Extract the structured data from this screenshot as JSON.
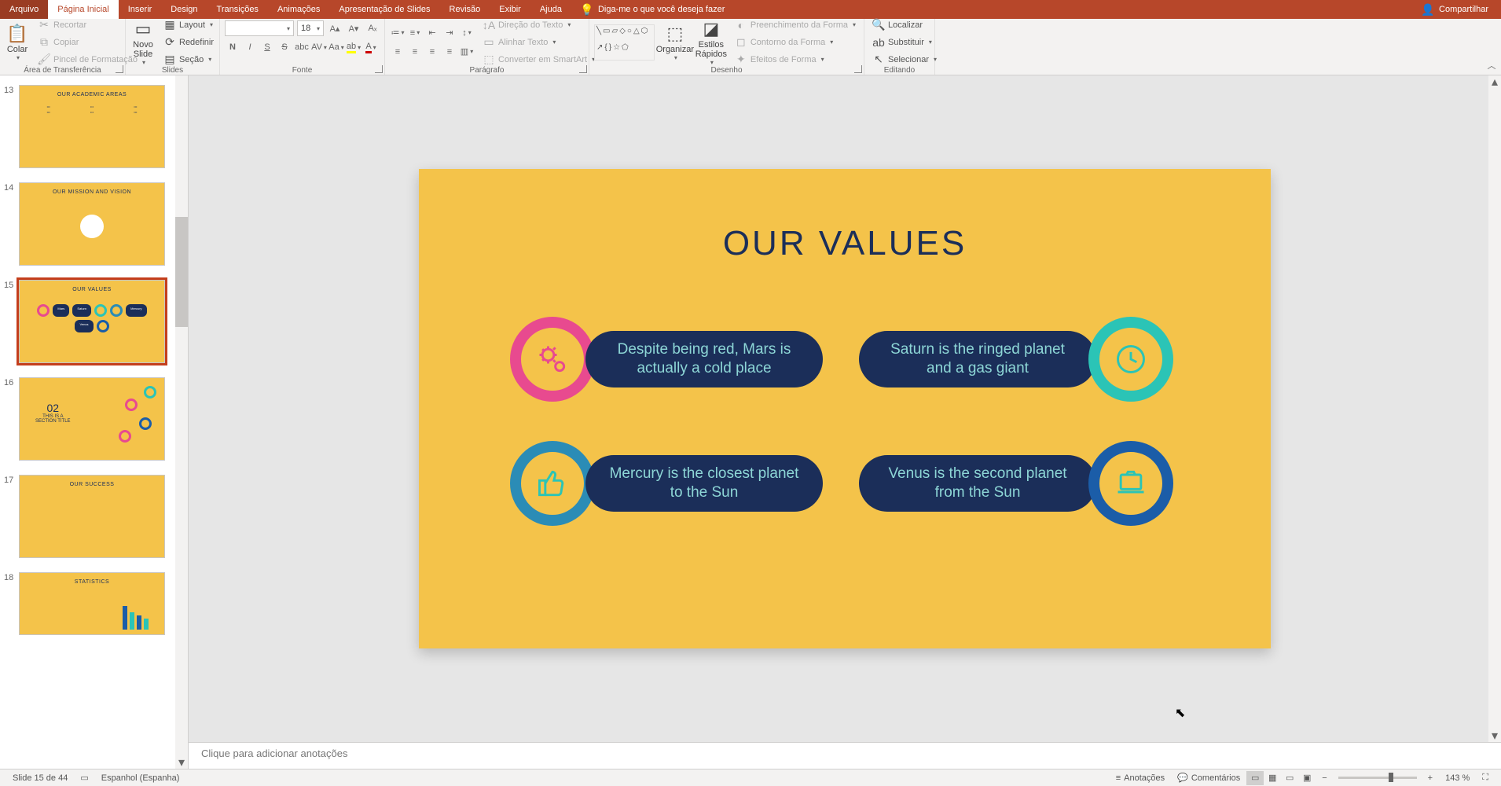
{
  "menubar": {
    "file": "Arquivo",
    "tabs": [
      "Página Inicial",
      "Inserir",
      "Design",
      "Transições",
      "Animações",
      "Apresentação de Slides",
      "Revisão",
      "Exibir",
      "Ajuda"
    ],
    "active_index": 0,
    "tellme": "Diga-me o que você deseja fazer",
    "share": "Compartilhar"
  },
  "ribbon": {
    "clipboard": {
      "paste": "Colar",
      "cut": "Recortar",
      "copy": "Copiar",
      "painter": "Pincel de Formatação",
      "label": "Área de Transferência"
    },
    "slides": {
      "new": "Novo\nSlide",
      "layout": "Layout",
      "reset": "Redefinir",
      "section": "Seção",
      "label": "Slides"
    },
    "font": {
      "name": "",
      "size": "18",
      "label": "Fonte"
    },
    "paragraph": {
      "text_direction": "Direção do Texto",
      "align_text": "Alinhar Texto",
      "smartart": "Converter em SmartArt",
      "label": "Parágrafo"
    },
    "drawing": {
      "arrange": "Organizar",
      "quick_styles": "Estilos\nRápidos",
      "fill": "Preenchimento da Forma",
      "outline": "Contorno da Forma",
      "effects": "Efeitos de Forma",
      "label": "Desenho"
    },
    "editing": {
      "find": "Localizar",
      "replace": "Substituir",
      "select": "Selecionar",
      "label": "Editando"
    }
  },
  "thumbs": [
    {
      "num": "13",
      "title": "OUR ACADEMIC AREAS"
    },
    {
      "num": "14",
      "title": "OUR MISSION AND VISION"
    },
    {
      "num": "15",
      "title": "OUR VALUES",
      "selected": true
    },
    {
      "num": "16",
      "title": "02",
      "subtitle": "THIS IS A\nSECTION TITLE"
    },
    {
      "num": "17",
      "title": "OUR SUCCESS"
    },
    {
      "num": "18",
      "title": "STATISTICS"
    }
  ],
  "slide": {
    "title": "OUR VALUES",
    "cards": [
      {
        "text": "Despite being red, Mars is actually a cold place",
        "icon": "gears",
        "ring": "#E84A8F",
        "icon_color": "#E84A8F"
      },
      {
        "text": "Saturn is the ringed planet and a gas giant",
        "icon": "clock",
        "ring": "#2BC4B6",
        "icon_color": "#2BC4B6"
      },
      {
        "text": "Mercury is the closest planet to the Sun",
        "icon": "thumb",
        "ring": "#2B8CB6",
        "icon_color": "#2BC4B6"
      },
      {
        "text": "Venus is the second planet from the Sun",
        "icon": "laptop",
        "ring": "#1B5DA8",
        "icon_color": "#2BC4B6"
      }
    ]
  },
  "notes_placeholder": "Clique para adicionar anotações",
  "status": {
    "slide_counter": "Slide 15 de 44",
    "language": "Espanhol (Espanha)",
    "notes": "Anotações",
    "comments": "Comentários",
    "zoom": "143 %"
  }
}
